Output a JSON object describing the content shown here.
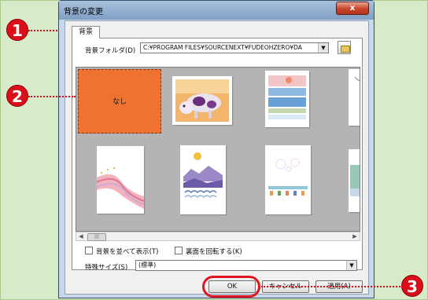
{
  "window": {
    "title": "背景の変更",
    "close_symbol": "x"
  },
  "tab": {
    "label": "背景"
  },
  "folder": {
    "label": "背景フォルダ(D)",
    "path": "C:¥PROGRAM FILES¥SOURCENEXT¥FUDEOHZERO¥DA",
    "browse_icon": "folder-icon"
  },
  "gallery": {
    "items": [
      {
        "label": "なし",
        "selected": true
      },
      {
        "label": ""
      },
      {
        "label": ""
      },
      {
        "label": ""
      },
      {
        "label": ""
      },
      {
        "label": ""
      },
      {
        "label": ""
      },
      {
        "label": ""
      }
    ]
  },
  "scrollbar": {
    "left_arrow": "◀",
    "right_arrow": "▶",
    "thumb_grip": "|||"
  },
  "options": {
    "arrange_label": "背景を並べて表示(T)",
    "rotate_back_label": "裏面を回転する(K)"
  },
  "size": {
    "label": "特殊サイズ(S)",
    "value": "(標準)"
  },
  "buttons": {
    "ok": "OK",
    "cancel": "キャンセル",
    "apply": "適用(A)"
  },
  "callouts": [
    "1",
    "2",
    "3"
  ],
  "colors": {
    "selection": "#ef7230",
    "callout": "#d90e18",
    "ok_highlight": "#e2141f"
  }
}
